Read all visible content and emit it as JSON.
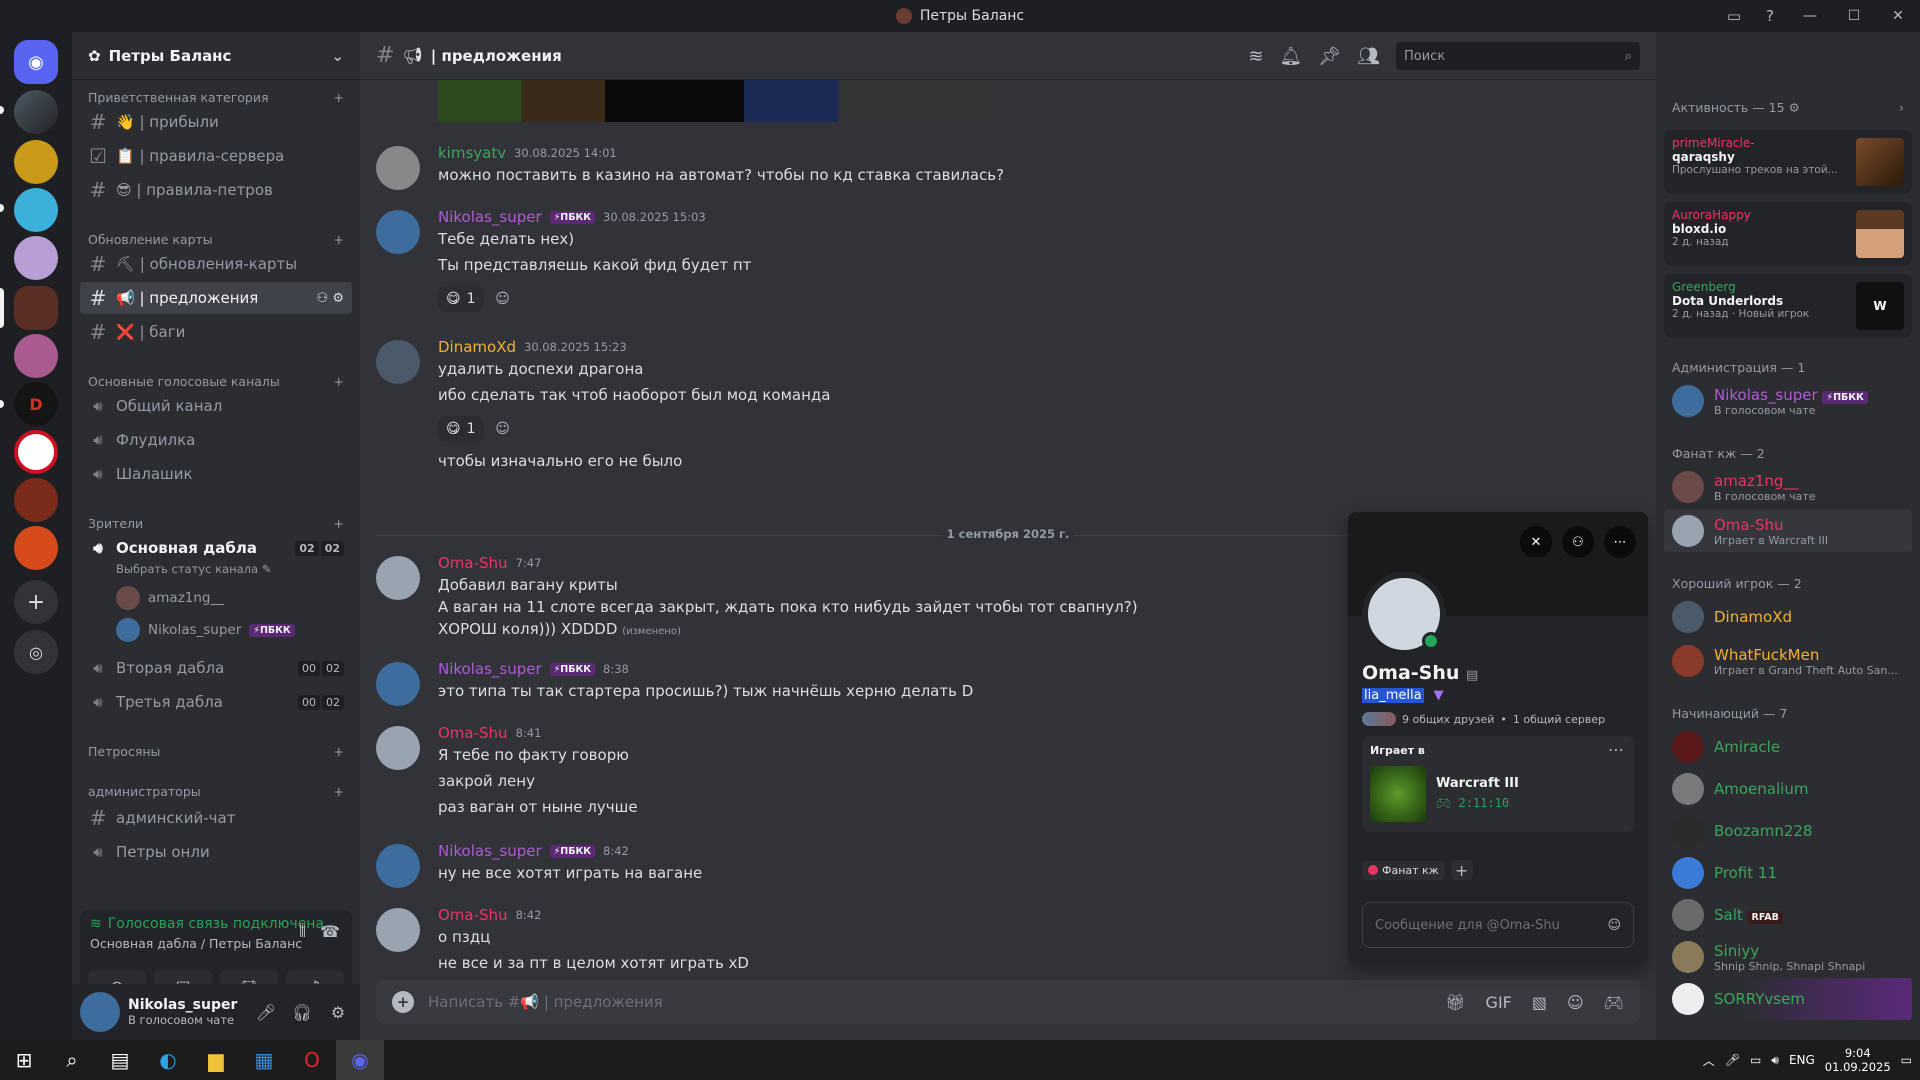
{
  "window": {
    "title": "Петры Баланс"
  },
  "colors": {
    "online": "#23a55a",
    "dnd": "#f23f43",
    "accent_green": "#3ba55d",
    "link_blue": "#00a8fc"
  },
  "server": {
    "name": "Петры Баланс"
  },
  "categories": {
    "welcome": "Приветственная категория",
    "map_update": "Обновление карты",
    "voice": "Основные голосовые каналы",
    "viewers": "Зрители",
    "petrosyny": "Петросяны",
    "admins": "администраторы"
  },
  "channels": {
    "arrived": "👋 | прибыли",
    "server_rules": "📋 | правила-сервера",
    "petr_rules": "😎 | правила-петров",
    "map_updates": "⛏ | обновления-карты",
    "suggestions": "📢 | предложения",
    "bugs": "❌ | баги",
    "general_voice": "Общий канал",
    "flood": "Флудилка",
    "shalashik": "Шалашик",
    "main_dabla": "Основная дабла",
    "main_dabla_status": "Выбрать статус канала",
    "main_dabla_count": [
      "02",
      "02"
    ],
    "second_dabla": "Вторая дабла",
    "second_dabla_count": [
      "00",
      "02"
    ],
    "third_dabla": "Третья дабла",
    "third_dabla_count": [
      "00",
      "02"
    ],
    "admin_chat": "админский-чат",
    "petry_only": "Петры онли"
  },
  "voice_users": [
    {
      "name": "amaz1ng__"
    },
    {
      "name": "Nikolas_super",
      "tag": "⚡ПБКК"
    }
  ],
  "voice_panel": {
    "status": "Голосовая связь подключена",
    "location": "Основная дабла / Петры Баланс"
  },
  "user_panel": {
    "name": "Nikolas_super",
    "status": "В голосовом чате"
  },
  "chat_header": {
    "channel": "| предложения",
    "search_placeholder": "Поиск"
  },
  "messages": [
    {
      "author": "kimsyatv",
      "color": "#3ba55d",
      "time": "30.08.2025 14:01",
      "lines": [
        "можно поставить в казино на автомат? чтобы по кд ставка ставилась?"
      ]
    },
    {
      "author": "Nikolas_super",
      "color": "#b05ad8",
      "tag": "⚡ПБКК",
      "time": "30.08.2025 15:03",
      "lines": [
        "Тебе делать нех)",
        "Ты представляешь какой фид будет пт"
      ],
      "reaction": {
        "emoji": "😋",
        "count": "1"
      }
    },
    {
      "author": "DinamoXd",
      "color": "#f0b232",
      "time": "30.08.2025 15:23",
      "lines": [
        "удалить доспехи драгона",
        "ибо сделать так чтоб наоборот был мод команда"
      ],
      "reaction": {
        "emoji": "😋",
        "count": "1"
      },
      "after": "чтобы изначально его не было"
    },
    {
      "author": "Oma-Shu",
      "color": "#e93563",
      "time": "7:47",
      "lines": [
        "Добавил вагану криты",
        "А ваган на 11 слоте всегда закрыт, ждать пока кто нибудь зайдет чтобы тот свапнул?)",
        "ХОРОШ коля))) XDDDD"
      ],
      "edited": "(изменено)"
    },
    {
      "author": "Nikolas_super",
      "color": "#b05ad8",
      "tag": "⚡ПБКК",
      "time": "8:38",
      "lines": [
        "это типа ты так стартера просишь?) тыж начнёшь херню делать D"
      ]
    },
    {
      "author": "Oma-Shu",
      "color": "#e93563",
      "time": "8:41",
      "lines": [
        "Я тебе по факту говорю",
        "закрой лену",
        "раз ваган от ныне лучше"
      ]
    },
    {
      "author": "Nikolas_super",
      "color": "#b05ad8",
      "tag": "⚡ПБКК",
      "time": "8:42",
      "lines": [
        "ну не все хотят играть на вагане"
      ]
    },
    {
      "author": "Oma-Shu",
      "color": "#e93563",
      "time": "8:42",
      "lines": [
        "о пздц",
        "не все и за пт в целом  хотят играть xD"
      ]
    }
  ],
  "date_divider": "1 сентября 2025 г.",
  "composer": {
    "placeholder": "Написать #📢 | предложения"
  },
  "popout": {
    "display_name": "Oma-Shu",
    "username": "lia_mella",
    "mutual": "9 общих друзей",
    "mutual_servers": "1 общий сервер",
    "activity_label": "Играет в",
    "game": "Warcraft III",
    "elapsed": "2:11:10",
    "role": "Фанат кж",
    "dm_placeholder": "Сообщение для @Oma-Shu"
  },
  "members": {
    "activity_header": "Активность — 15",
    "activities": [
      {
        "user": "primeMiracle-",
        "title": "qaraqshy",
        "sub": "Прослушано треков на этой..."
      },
      {
        "user": "AuroraHappy",
        "title": "bloxd.io",
        "sub": "2 д. назад"
      },
      {
        "user": "Greenberg",
        "title": "Dota Underlords",
        "sub": "2 д. назад",
        "sub2": "Новый игрок"
      }
    ],
    "groups": [
      {
        "header": "Администрация — 1",
        "items": [
          {
            "name": "Nikolas_super",
            "tag": "⚡ПБКК",
            "color": "#b05ad8",
            "sub": "В голосовом чате"
          }
        ]
      },
      {
        "header": "Фанат кж — 2",
        "items": [
          {
            "name": "amaz1ng__",
            "color": "#e93563",
            "sub": "В голосовом чате"
          },
          {
            "name": "Oma-Shu",
            "color": "#e93563",
            "sub": "Играет в Warcraft III"
          }
        ]
      },
      {
        "header": "Хороший игрок — 2",
        "items": [
          {
            "name": "DinamoXd",
            "color": "#f0b232"
          },
          {
            "name": "WhatFuckMen",
            "color": "#f0b232",
            "sub": "Играет в Grand Theft Auto San..."
          }
        ]
      },
      {
        "header": "Начинающий — 7",
        "items": [
          {
            "name": "Amiracle",
            "color": "#3ba55d"
          },
          {
            "name": "Amoenalium",
            "color": "#3ba55d"
          },
          {
            "name": "Boozamn228",
            "color": "#3ba55d"
          },
          {
            "name": "Profit 11",
            "color": "#3ba55d"
          },
          {
            "name": "Salt",
            "color": "#3ba55d",
            "tag": "RFAB"
          },
          {
            "name": "Siniyy",
            "color": "#3ba55d",
            "sub": "Shnip Shnip, Shnapi Shnapi"
          },
          {
            "name": "SORRYvsem",
            "color": "#3ba55d"
          }
        ]
      }
    ]
  },
  "taskbar": {
    "lang": "ENG",
    "time": "9:04",
    "date": "01.09.2025"
  }
}
